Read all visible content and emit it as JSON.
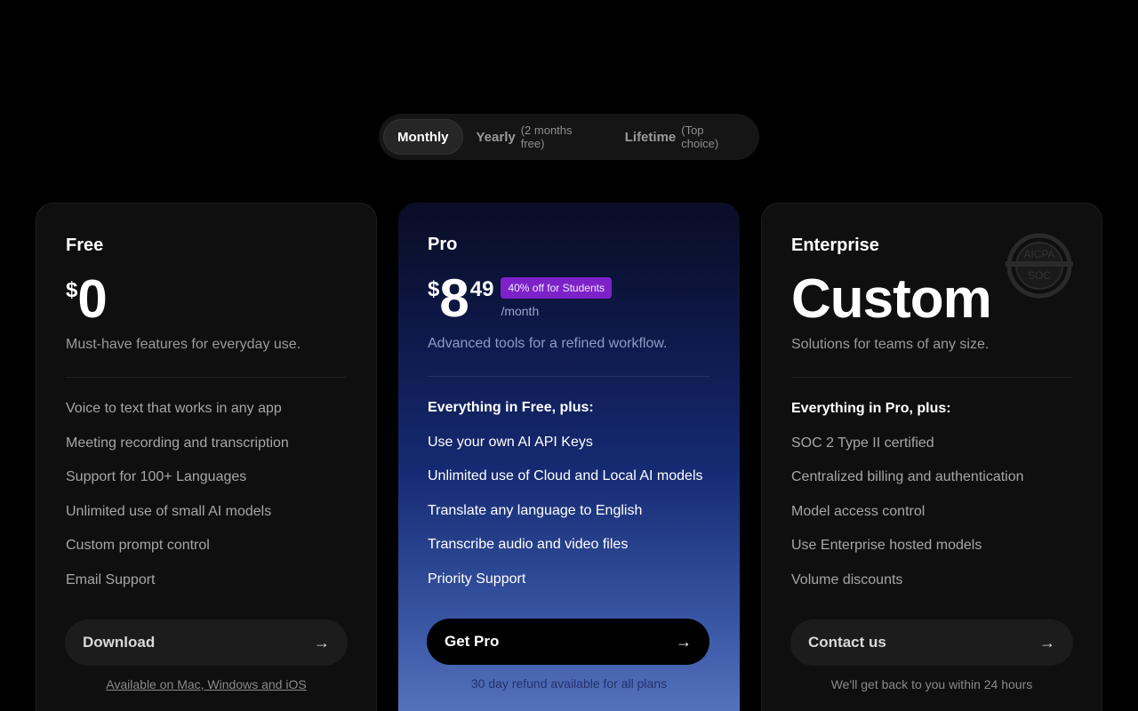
{
  "toggle": {
    "monthly": "Monthly",
    "yearly": "Yearly",
    "yearly_sub": "(2 months free)",
    "lifetime": "Lifetime",
    "lifetime_sub": "(Top choice)"
  },
  "plans": {
    "free": {
      "name": "Free",
      "currency": "$",
      "amount": "0",
      "tagline": "Must-have features for everyday use.",
      "features": [
        "Voice to text that works in any app",
        "Meeting recording and transcription",
        "Support for 100+ Languages",
        "Unlimited use of small AI models",
        "Custom prompt control",
        "Email Support"
      ],
      "cta": "Download",
      "note": "Available on Mac, Windows and iOS"
    },
    "pro": {
      "name": "Pro",
      "currency": "$",
      "amount": "8",
      "cents": "49",
      "badge": "40% off for Students",
      "per": "/month",
      "tagline": "Advanced tools for a refined workflow.",
      "lead": "Everything in Free, plus:",
      "features": [
        "Use your own AI API Keys",
        "Unlimited use of Cloud and Local AI models",
        "Translate any language to English",
        "Transcribe audio and video files",
        "Priority Support"
      ],
      "cta": "Get Pro",
      "note": "30 day refund available for all plans"
    },
    "enterprise": {
      "name": "Enterprise",
      "amount": "Custom",
      "tagline": "Solutions for teams of any size.",
      "lead": "Everything in Pro, plus:",
      "features": [
        "SOC 2 Type II certified",
        "Centralized billing and authentication",
        "Model access control",
        "Use Enterprise hosted models",
        "Volume discounts"
      ],
      "cta": "Contact us",
      "note": "We'll get back to you within 24 hours",
      "seal_text_top": "AICPA",
      "seal_text_bottom": "SOC"
    }
  },
  "icons": {
    "arrow": "arrow-right-icon",
    "seal": "aicpa-soc-seal-icon"
  },
  "colors": {
    "badge": "#7d22c9",
    "pro_gradient_top": "#0a0d24",
    "pro_gradient_bottom": "#5b79c2"
  }
}
